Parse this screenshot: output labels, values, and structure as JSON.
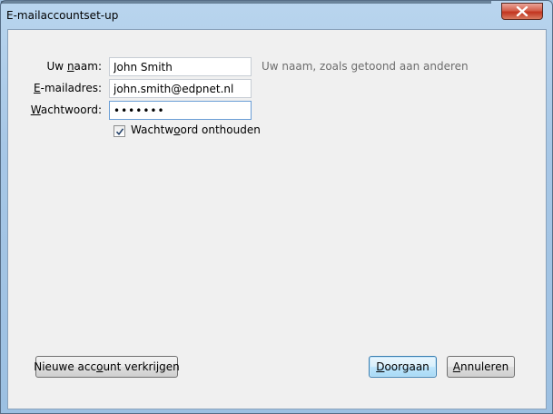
{
  "window": {
    "title": "E-mailaccountset-up"
  },
  "form": {
    "name": {
      "label_pre": "Uw ",
      "label_ul": "n",
      "label_post": "aam:",
      "value": "John Smith",
      "hint": "Uw naam, zoals getoond aan anderen"
    },
    "email": {
      "label_pre": "",
      "label_ul": "E",
      "label_post": "-mailadres:",
      "value": "john.smith@edpnet.nl"
    },
    "password": {
      "label_pre": "",
      "label_ul": "W",
      "label_post": "achtwoord:",
      "value": "•••••••"
    },
    "remember": {
      "label_pre": "Wachtw",
      "label_ul": "o",
      "label_post": "ord onthouden",
      "checked": true
    }
  },
  "buttons": {
    "new_account": {
      "pre": "Nieuwe acc",
      "ul": "o",
      "post": "unt verkrijgen"
    },
    "continue": {
      "pre": "",
      "ul": "D",
      "post": "oorgaan"
    },
    "cancel": {
      "pre": "",
      "ul": "A",
      "post": "nnuleren"
    }
  },
  "icons": {
    "close": "close-x-icon",
    "check": "checkmark-icon"
  },
  "colors": {
    "close_button": "#c2351f",
    "default_button_border": "#3c7fb1",
    "focus_border": "#6a9ed6"
  }
}
